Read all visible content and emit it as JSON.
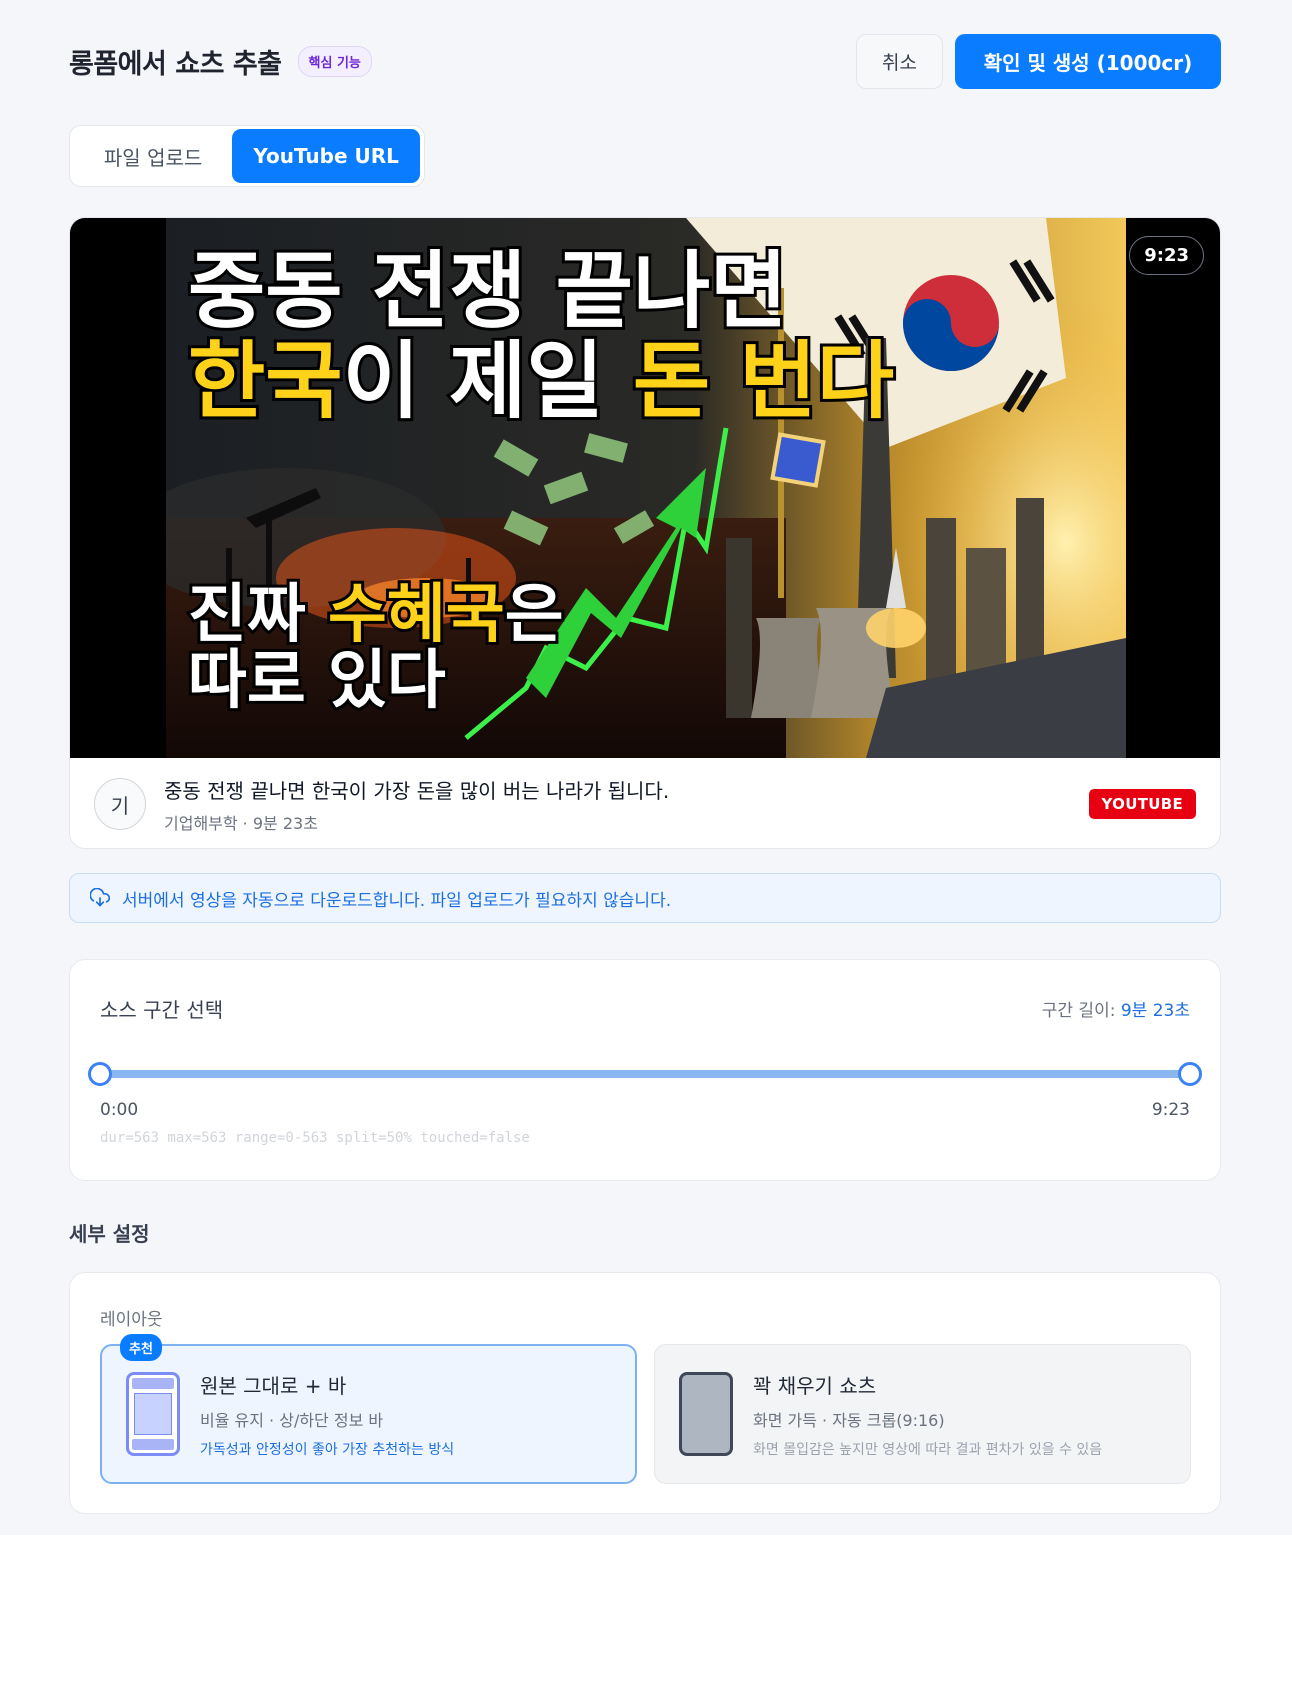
{
  "header": {
    "title": "롱폼에서 쇼츠 추출",
    "core_badge": "핵심 기능",
    "cancel_label": "취소",
    "confirm_label": "확인 및 생성 (1000cr)"
  },
  "tabs": [
    {
      "label": "파일 업로드",
      "active": false
    },
    {
      "label": "YouTube URL",
      "active": true
    }
  ],
  "video": {
    "thumbnail_text": {
      "line1": "중동 전쟁 끝나면",
      "line2_a": "한국",
      "line2_b": "이 제일 ",
      "line2_c": "돈 번다",
      "line3_a": "진짜 ",
      "line3_b": "수혜국",
      "line3_c": "은",
      "line4": "따로 있다"
    },
    "duration": "9:23",
    "avatar_alt": "기",
    "title": "중동 전쟁 끝나면 한국이 가장 돈을 많이 버는 나라가 됩니다.",
    "meta": "기업해부학 · 9분 23초",
    "source_badge": "YOUTUBE"
  },
  "notice": {
    "icon": "cloud-download-icon",
    "text": "서버에서 영상을 자동으로 다운로드합니다. 파일 업로드가 필요하지 않습니다."
  },
  "range": {
    "title": "소스 구간 선택",
    "length_label": "구간 길이: ",
    "length_value": "9분 23초",
    "start_label": "0:00",
    "end_label": "9:23",
    "start_fraction": 0,
    "end_fraction": 1,
    "debug": "dur=563 max=563 range=0-563 split=50% touched=false"
  },
  "details": {
    "section_title": "세부 설정",
    "layout_label": "레이아웃",
    "options": [
      {
        "badge": "추천",
        "title": "원본 그대로 + 바",
        "subtitle": "비율 유지 · 상/하단 정보 바",
        "note": "가독성과 안정성이 좋아 가장 추천하는 방식",
        "selected": true
      },
      {
        "title": "꽉 채우기 쇼츠",
        "subtitle": "화면 가득 · 자동 크롭(9:16)",
        "note": "화면 몰입감은 높지만 영상에 따라 결과 편차가 있을 수 있음",
        "selected": false
      }
    ]
  },
  "colors": {
    "primary": "#0a7cff",
    "youtube_red": "#e60012",
    "thumb_yellow": "#ffd21a"
  }
}
